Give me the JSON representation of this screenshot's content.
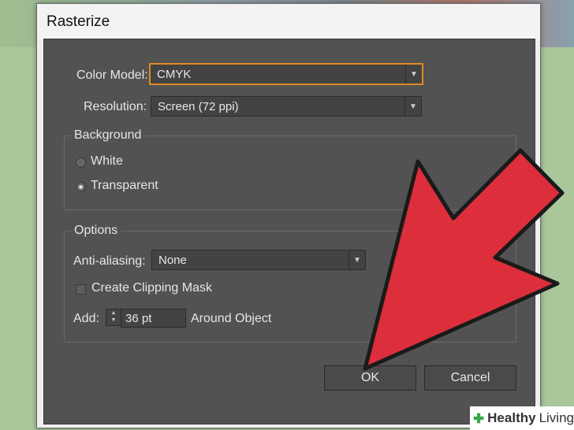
{
  "window": {
    "title": "Rasterize"
  },
  "color_model": {
    "label": "Color Model:",
    "value": "CMYK"
  },
  "resolution": {
    "label": "Resolution:",
    "value": "Screen (72 ppi)"
  },
  "background": {
    "title": "Background",
    "options": [
      "White",
      "Transparent"
    ],
    "selected": "Transparent"
  },
  "options": {
    "title": "Options",
    "anti_aliasing": {
      "label": "Anti-aliasing:",
      "value": "None"
    },
    "clipping_mask": {
      "label": "Create Clipping Mask",
      "checked": false
    },
    "add": {
      "label": "Add:",
      "value": "36 pt",
      "suffix": "Around Object"
    }
  },
  "buttons": {
    "ok": "OK",
    "cancel": "Cancel"
  },
  "watermark": {
    "brand_bold": "Healthy",
    "brand": "Living"
  },
  "colors": {
    "accent_focus": "#e08a25",
    "arrow": "#dd2e3c"
  }
}
